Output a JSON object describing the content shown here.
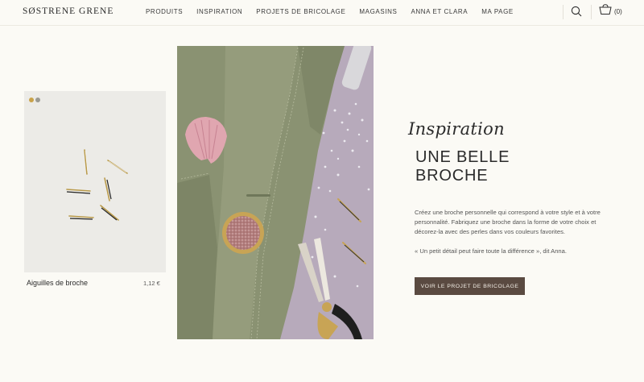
{
  "header": {
    "logo": "SØSTRENE GRENE",
    "nav": [
      {
        "label": "PRODUITS"
      },
      {
        "label": "INSPIRATION"
      },
      {
        "label": "PROJETS DE BRICOLAGE"
      },
      {
        "label": "MAGASINS"
      },
      {
        "label": "ANNA ET CLARA"
      },
      {
        "label": "MA PAGE"
      }
    ],
    "search_icon": "search-icon",
    "cart_icon": "basket-icon",
    "cart_count": "(0)"
  },
  "product": {
    "name": "Aiguilles de broche",
    "price": "1,12 €",
    "swatch_colors": [
      "#c9a24a",
      "#9a9a92"
    ]
  },
  "inspiration": {
    "script_title": "Inspiration",
    "title": "UNE BELLE BROCHE",
    "description": "Créez une broche personnelle qui correspond à votre style et à votre personnalité. Fabriquez une broche dans la forme de votre choix et décorez-la avec des perles dans vos couleurs favorites.",
    "quote": "« Un petit détail peut faire toute la différence », dit Anna.",
    "cta_label": "VOIR LE PROJET DE BRICOLAGE"
  },
  "colors": {
    "background": "#fbfaf5",
    "accent": "#5a4a41",
    "jacket": "#8c9474",
    "surface": "#b4a6b8"
  }
}
